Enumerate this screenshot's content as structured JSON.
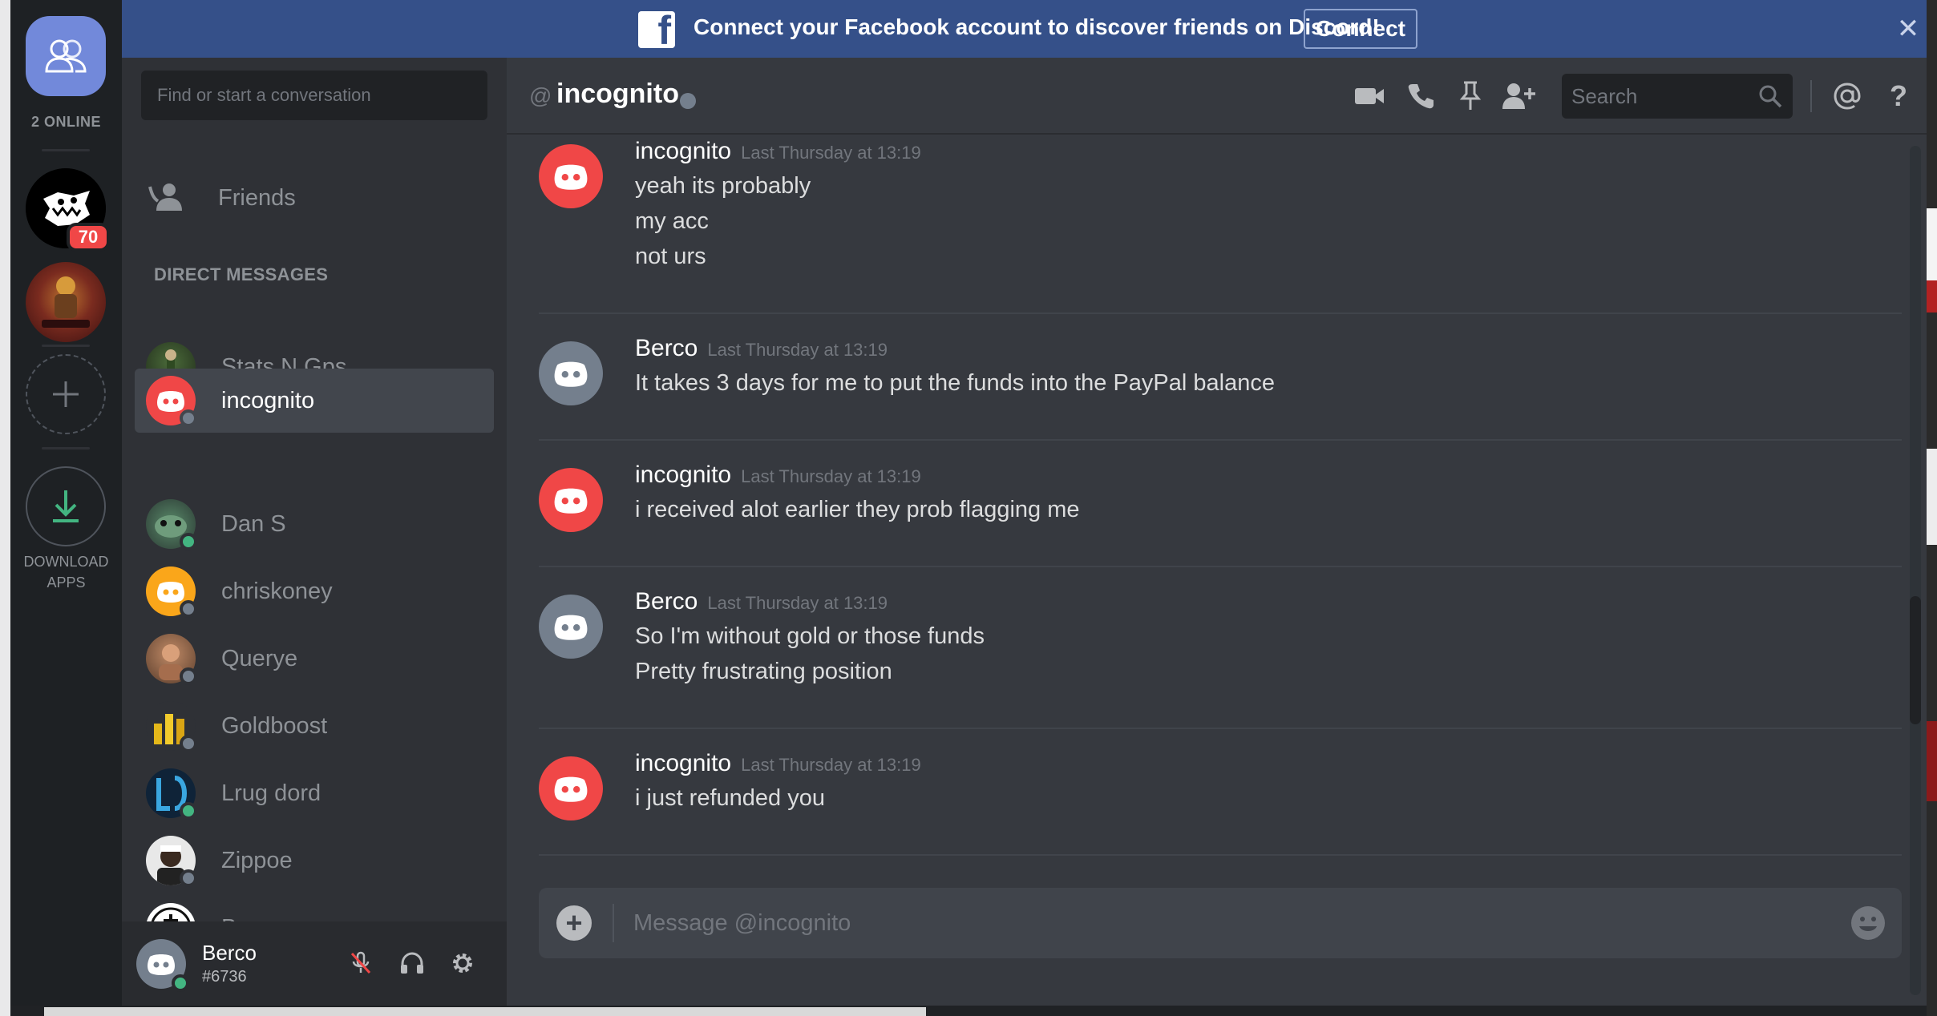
{
  "banner": {
    "text": "Connect your Facebook account to discover friends on Discord!",
    "connect_label": "Connect",
    "close_label": "✕"
  },
  "server_rail": {
    "online_count": "2 ONLINE",
    "server_badge": "70",
    "download_label_line1": "DOWNLOAD",
    "download_label_line2": "APPS"
  },
  "dm_sidebar": {
    "search_placeholder": "Find or start a conversation",
    "friends_label": "Friends",
    "section_header": "DIRECT MESSAGES",
    "items": [
      {
        "name": "Stats N Gps",
        "status": "offline"
      },
      {
        "name": "incognito",
        "status": "offline"
      },
      {
        "name": "Dan S",
        "status": "online"
      },
      {
        "name": "chriskoney",
        "status": "offline"
      },
      {
        "name": "Querye",
        "status": "offline"
      },
      {
        "name": "Goldboost",
        "status": "offline"
      },
      {
        "name": "Lrug dord",
        "status": "online"
      },
      {
        "name": "Zippoe",
        "status": "offline"
      },
      {
        "name": "Bazuso",
        "status": "offline"
      }
    ]
  },
  "user_panel": {
    "username": "Berco",
    "discriminator": "#6736"
  },
  "chat": {
    "header_at": "@",
    "channel_title": "incognito",
    "search_placeholder": "Search",
    "composer_placeholder": "Message @incognito",
    "messages": [
      {
        "author": "incognito",
        "timestamp": "Last Thursday at 13:19",
        "lines": [
          "yeah its probably",
          "my acc",
          "not urs"
        ]
      },
      {
        "author": "Berco",
        "timestamp": "Last Thursday at 13:19",
        "lines": [
          "It takes 3 days for me to put the funds into the PayPal balance"
        ]
      },
      {
        "author": "incognito",
        "timestamp": "Last Thursday at 13:19",
        "lines": [
          "i received alot earlier they prob flagging me"
        ]
      },
      {
        "author": "Berco",
        "timestamp": "Last Thursday at 13:19",
        "lines": [
          "So I'm without gold or those funds",
          "Pretty frustrating position"
        ]
      },
      {
        "author": "incognito",
        "timestamp": "Last Thursday at 13:19",
        "lines": [
          "i just refunded you"
        ]
      }
    ]
  },
  "colors": {
    "blurple": "#7289da",
    "online": "#43b581",
    "danger": "#f04747",
    "facebook": "#355089"
  }
}
